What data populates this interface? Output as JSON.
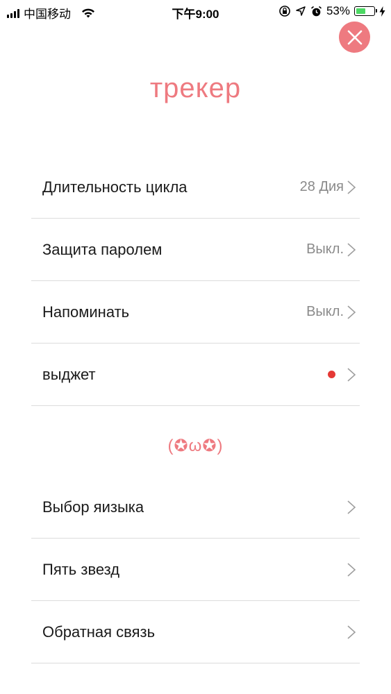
{
  "status_bar": {
    "carrier": "中国移动",
    "time": "下午9:00",
    "battery_percent": "53%",
    "battery_level": 0.53,
    "icons": [
      "signal-icon",
      "wifi-icon",
      "orientation-lock-icon",
      "location-icon",
      "alarm-icon",
      "battery-icon",
      "charging-icon"
    ]
  },
  "close_icon": "close-icon",
  "title": "трекер",
  "section1": [
    {
      "label": "Длительность цикла",
      "value": "28 Дия"
    },
    {
      "label": "Защита паролем",
      "value": "Выкл."
    },
    {
      "label": "Напоминать",
      "value": "Выкл."
    },
    {
      "label": "выджет",
      "value": ""
    }
  ],
  "kaomoji": "(✪ω✪)",
  "section2": [
    {
      "label": "Выбор яизыка"
    },
    {
      "label": "Пять звезд"
    },
    {
      "label": "Обратная связь"
    }
  ],
  "colors": {
    "accent": "#ee7a80",
    "badge": "#e53935",
    "divider": "#dcdcdc",
    "value_text": "#8a8a8a"
  }
}
